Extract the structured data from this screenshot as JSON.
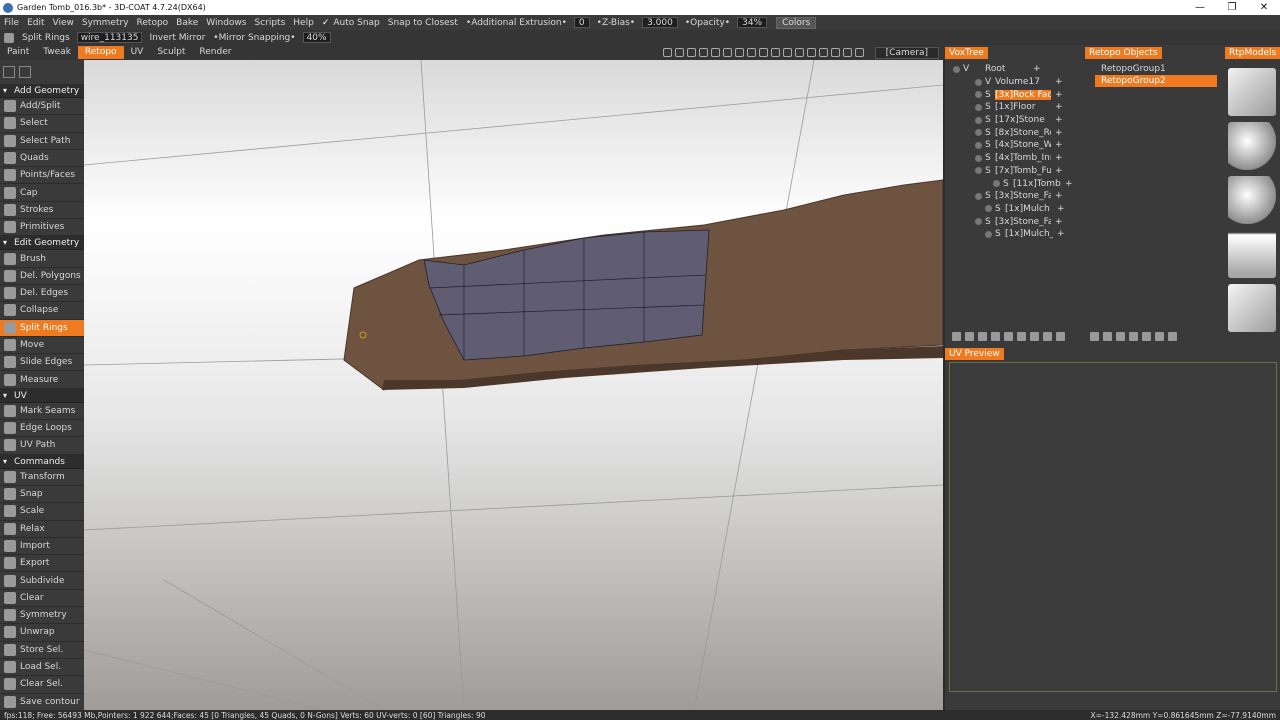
{
  "window": {
    "title": "Garden Tomb_016.3b* - 3D-COAT 4.7.24(DX64)",
    "controls": [
      "—",
      "❐",
      "✕"
    ]
  },
  "menubar": {
    "menus": [
      "File",
      "Edit",
      "View",
      "Symmetry",
      "Retopo",
      "Bake",
      "Windows",
      "Scripts",
      "Help"
    ],
    "auto_snap_check": "✓",
    "auto_snap_label": "Auto Snap",
    "snap_mode": "Snap to Closest",
    "additional_extrusion_label": "•Additional Extrusion•",
    "additional_extrusion_value": "0",
    "zbias_label": "•Z-Bias•",
    "zbias_value": "3.000",
    "opacity_label": "•Opacity•",
    "opacity_value": "34%",
    "colors_button": "Colors"
  },
  "toolbar2": {
    "current_tool": "Split Rings",
    "wire_select": "wire_113135",
    "invert_mirror": "Invert Mirror",
    "mirror_snapping_label": "•Mirror Snapping•",
    "mirror_snapping_value": "40%"
  },
  "room_tabs": [
    "Paint",
    "Tweak",
    "Retopo",
    "UV",
    "Sculpt",
    "Render"
  ],
  "camera_select": "[Camera]",
  "left_panel": {
    "sections": [
      {
        "header": "Add Geometry",
        "tools": [
          "Add/Split",
          "Select",
          "Select Path",
          "Quads",
          "Points/Faces",
          "Cap",
          "Strokes",
          "Primitives"
        ]
      },
      {
        "header": "Edit Geometry",
        "tools": [
          "Brush",
          "Del. Polygons",
          "Del. Edges",
          "Collapse",
          "Split Rings",
          "Move",
          "Slide Edges",
          "Measure"
        ]
      },
      {
        "header": "UV",
        "tools": [
          "Mark Seams",
          "Edge Loops",
          "UV Path"
        ]
      },
      {
        "header": "Commands",
        "tools": [
          "Transform",
          "Snap",
          "Scale",
          "Relax",
          "Import",
          "Export",
          "Subdivide",
          "Clear",
          "Symmetry",
          "Unwrap",
          "Store Sel.",
          "Load Sel.",
          "Clear Sel.",
          "Save contour"
        ]
      }
    ]
  },
  "panels": {
    "voxtree_tab": "VoxTree",
    "retopo_objects_tab": "Retopo Objects",
    "rtpmodels_tab": "RtpModels",
    "uv_preview_tab": "UV Preview"
  },
  "voxtree": [
    {
      "type": "V",
      "name": "Root",
      "plus": "+"
    },
    {
      "type": "V",
      "name": "Volume17",
      "plus": "+"
    },
    {
      "type": "S",
      "name": "[3x]Rock Fac",
      "plus": "+"
    },
    {
      "type": "S",
      "name": "[1x]Floor",
      "plus": "+"
    },
    {
      "type": "S",
      "name": "[17x]Stone",
      "plus": "+"
    },
    {
      "type": "S",
      "name": "[8x]Stone_Re",
      "plus": "+"
    },
    {
      "type": "S",
      "name": "[4x]Stone_Wa",
      "plus": "+"
    },
    {
      "type": "S",
      "name": "[4x]Tomb_Inn",
      "plus": "+"
    },
    {
      "type": "S",
      "name": "[7x]Tomb_Ful",
      "plus": "+"
    },
    {
      "type": "S",
      "name": "[11x]Tomb",
      "plus": "+"
    },
    {
      "type": "S",
      "name": "[3x]Stone_Fa",
      "plus": "+"
    },
    {
      "type": "S",
      "name": "[1x]Mulch",
      "plus": "+"
    },
    {
      "type": "S",
      "name": "[3x]Stone_Fa",
      "plus": "+"
    },
    {
      "type": "S",
      "name": "[1x]Mulch_",
      "plus": "+"
    }
  ],
  "retopo_objects": [
    "RetopoGroup1",
    "RetopoGroup2"
  ],
  "rtpmodels": [
    "l-shape-icon",
    "capsule-icon",
    "cylinder-icon",
    "cone-icon",
    "cube-icon"
  ],
  "statusbar": {
    "left": "fps:118;   Free: 56493 Mb,Pointers: 1 922 644;Faces: 45  [0  Triangles, 45 Quads, 0 N-Gons]  Verts: 60   UV-verts: 0  [60]  Triangles: 90",
    "coords": "X=-132.428mm  Y=0.861645mm  Z=-77.9140mm"
  }
}
